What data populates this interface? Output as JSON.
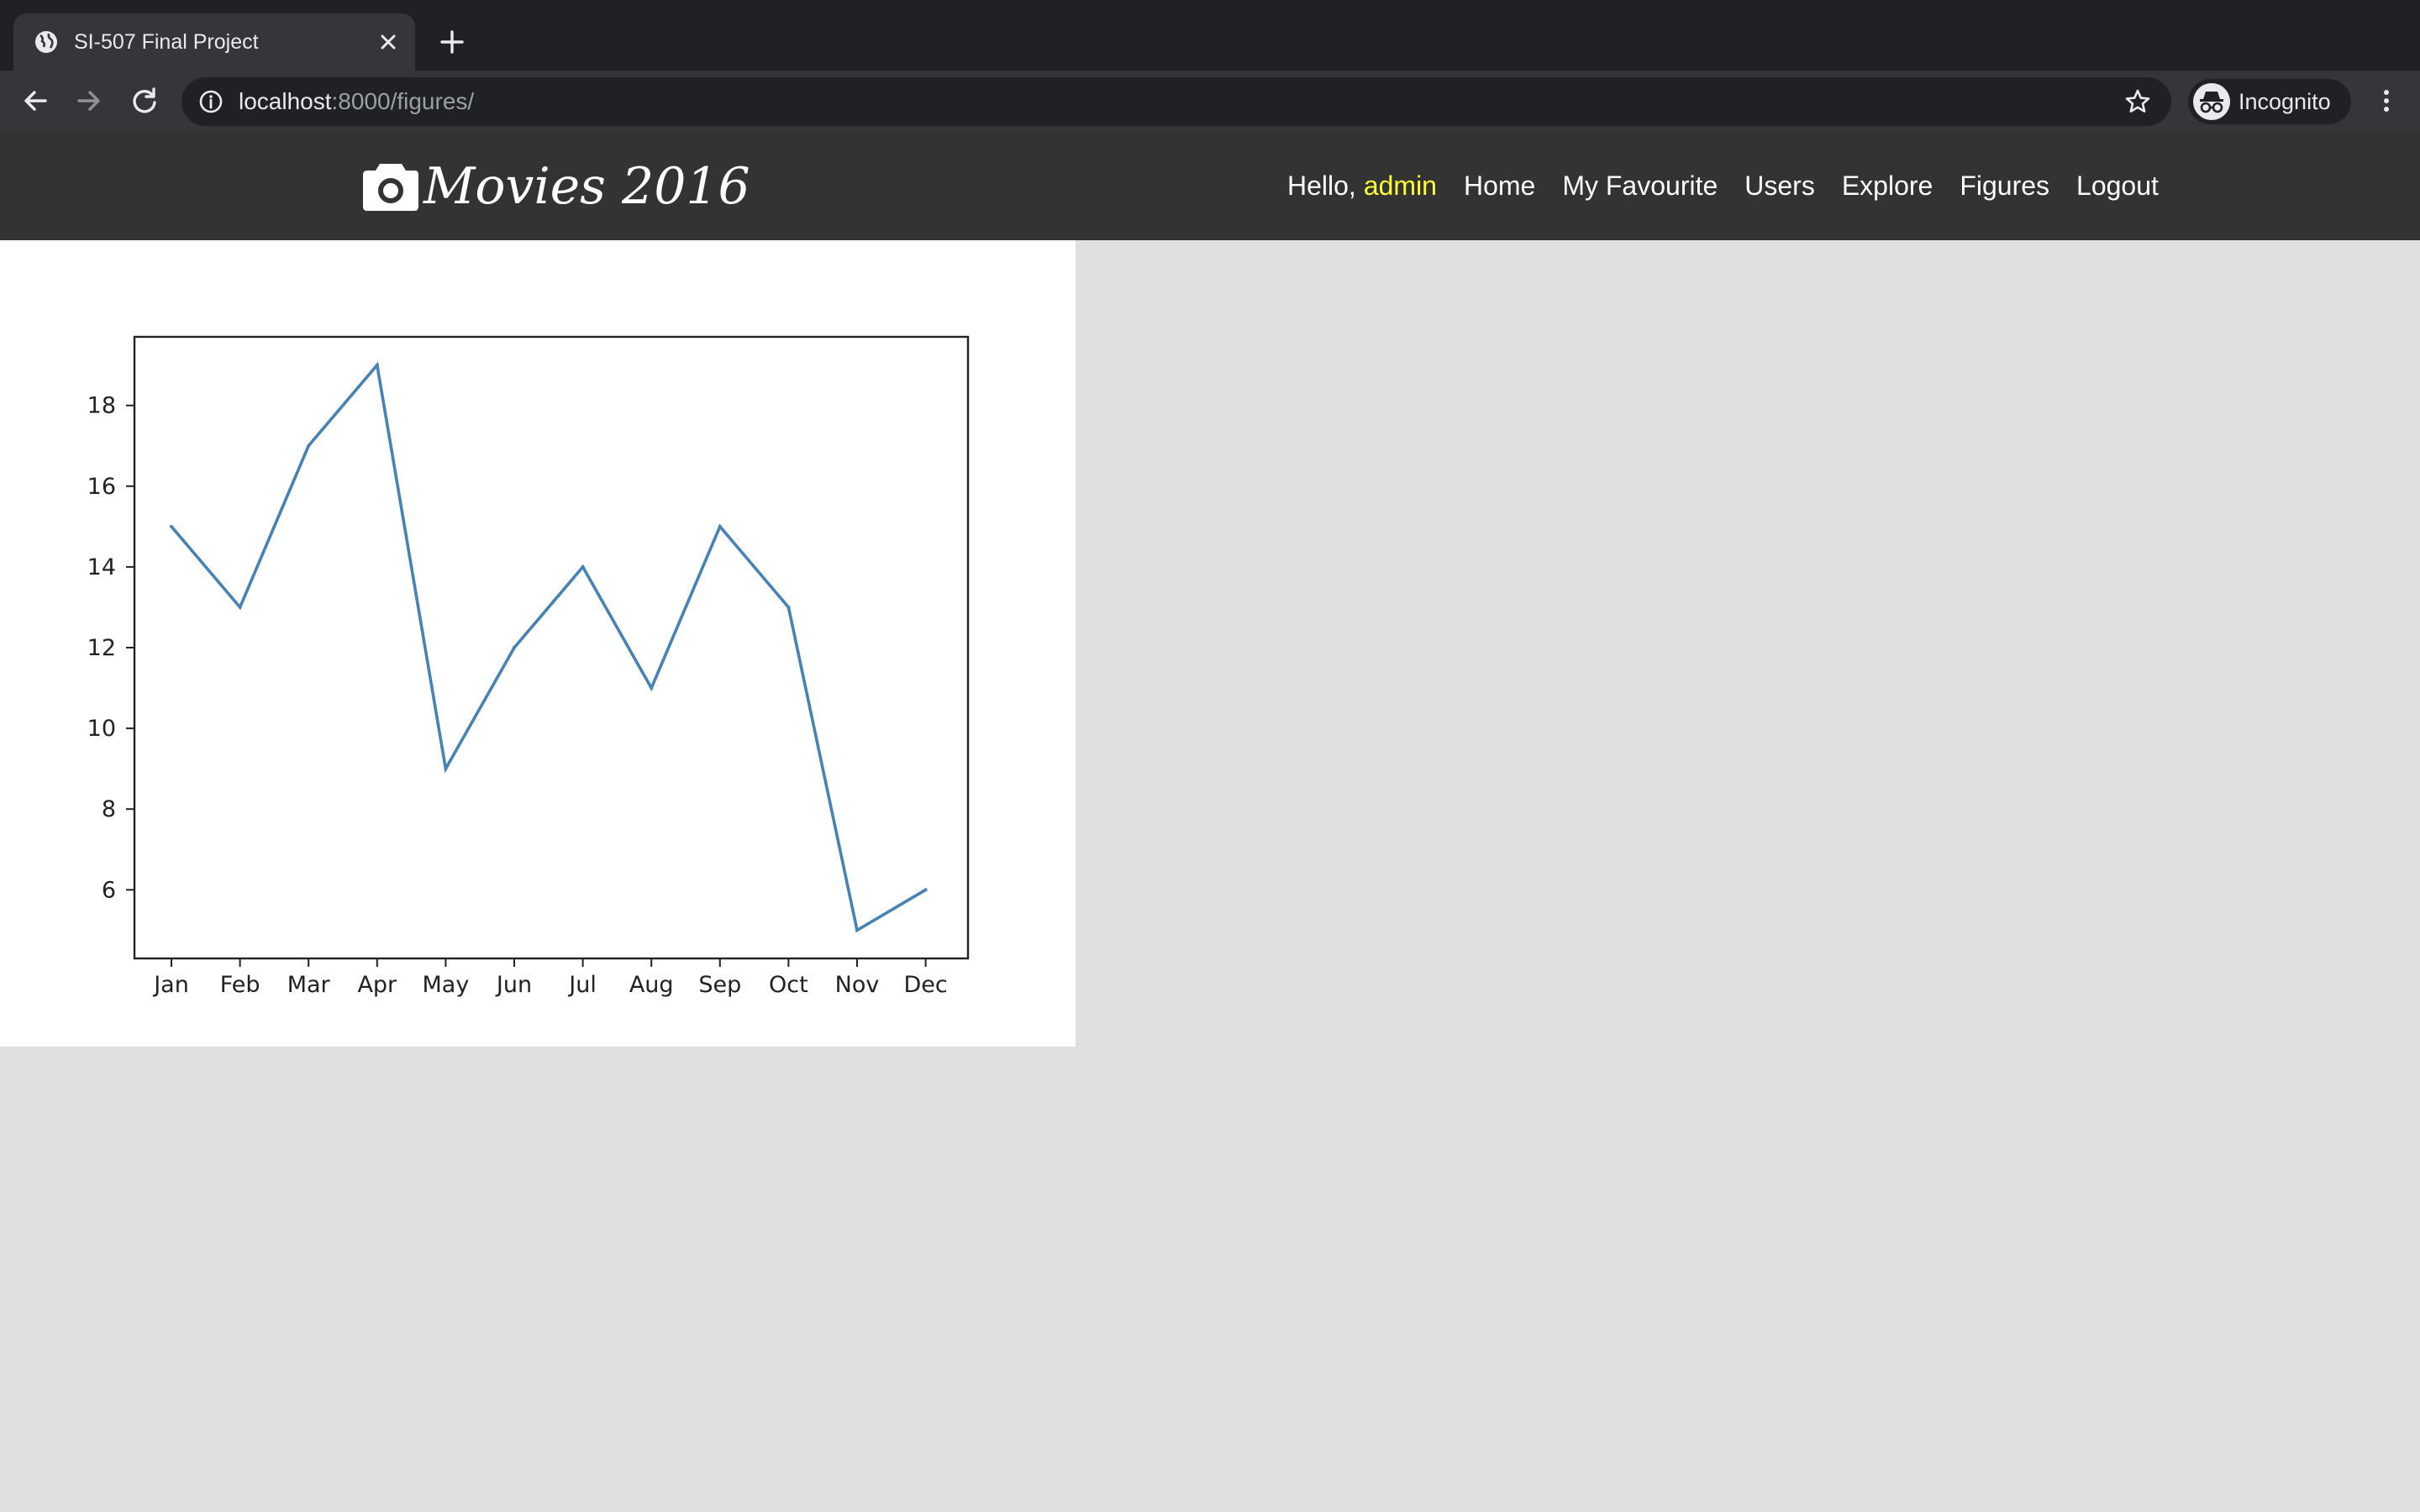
{
  "browser": {
    "tab_title": "SI-507 Final Project",
    "url_host": "localhost",
    "url_path": ":8000/figures/",
    "profile_label": "Incognito",
    "icons": {
      "favicon": "globe-icon",
      "close": "close-icon",
      "new_tab": "plus-icon",
      "back": "arrow-left-icon",
      "forward": "arrow-right-icon",
      "reload": "reload-icon",
      "info": "info-icon",
      "bookmark": "star-icon",
      "profile": "incognito-icon",
      "menu": "kebab-menu-icon"
    }
  },
  "site": {
    "brand": "Movies 2016",
    "brand_icon": "camera-icon",
    "greeting": "Hello,",
    "username": "admin",
    "username_color": "#ffff33",
    "nav": [
      "Home",
      "My Favourite",
      "Users",
      "Explore",
      "Figures",
      "Logout"
    ]
  },
  "chart_data": {
    "type": "line",
    "title": "",
    "xlabel": "",
    "ylabel": "",
    "categories": [
      "Jan",
      "Feb",
      "Mar",
      "Apr",
      "May",
      "Jun",
      "Jul",
      "Aug",
      "Sep",
      "Oct",
      "Nov",
      "Dec"
    ],
    "values": [
      15,
      13,
      17,
      19,
      9,
      12,
      14,
      11,
      15,
      13,
      5,
      6
    ],
    "ylim": [
      4.3,
      19.7
    ],
    "yticks": [
      6,
      8,
      10,
      12,
      14,
      16,
      18
    ],
    "line_color": "#4682b4",
    "grid": false,
    "legend": "none"
  }
}
